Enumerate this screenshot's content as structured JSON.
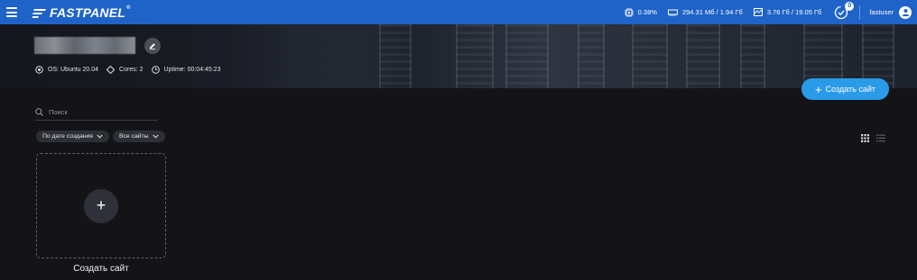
{
  "topbar": {
    "logo_text": "FASTPANEL",
    "logo_reg": "®",
    "cpu": "0.38%",
    "ram": "294.31 Мб / 1.94 Гб",
    "disk": "3.76 Гб / 19.05 Гб",
    "notifications_count": "0",
    "username": "fastuser"
  },
  "server": {
    "os": "OS: Ubuntu 20.04",
    "cores": "Cores: 2",
    "uptime": "Uptime: 00:04:45:23"
  },
  "actions": {
    "create_site": "Создать сайт"
  },
  "search": {
    "placeholder": "Поиск"
  },
  "filters": {
    "sort": "По дате создания",
    "scope": "Все сайты"
  },
  "card": {
    "add_label": "Создать сайт"
  },
  "colors": {
    "topbar": "#1f63c8",
    "accent": "#2a9be8",
    "background": "#141417"
  }
}
